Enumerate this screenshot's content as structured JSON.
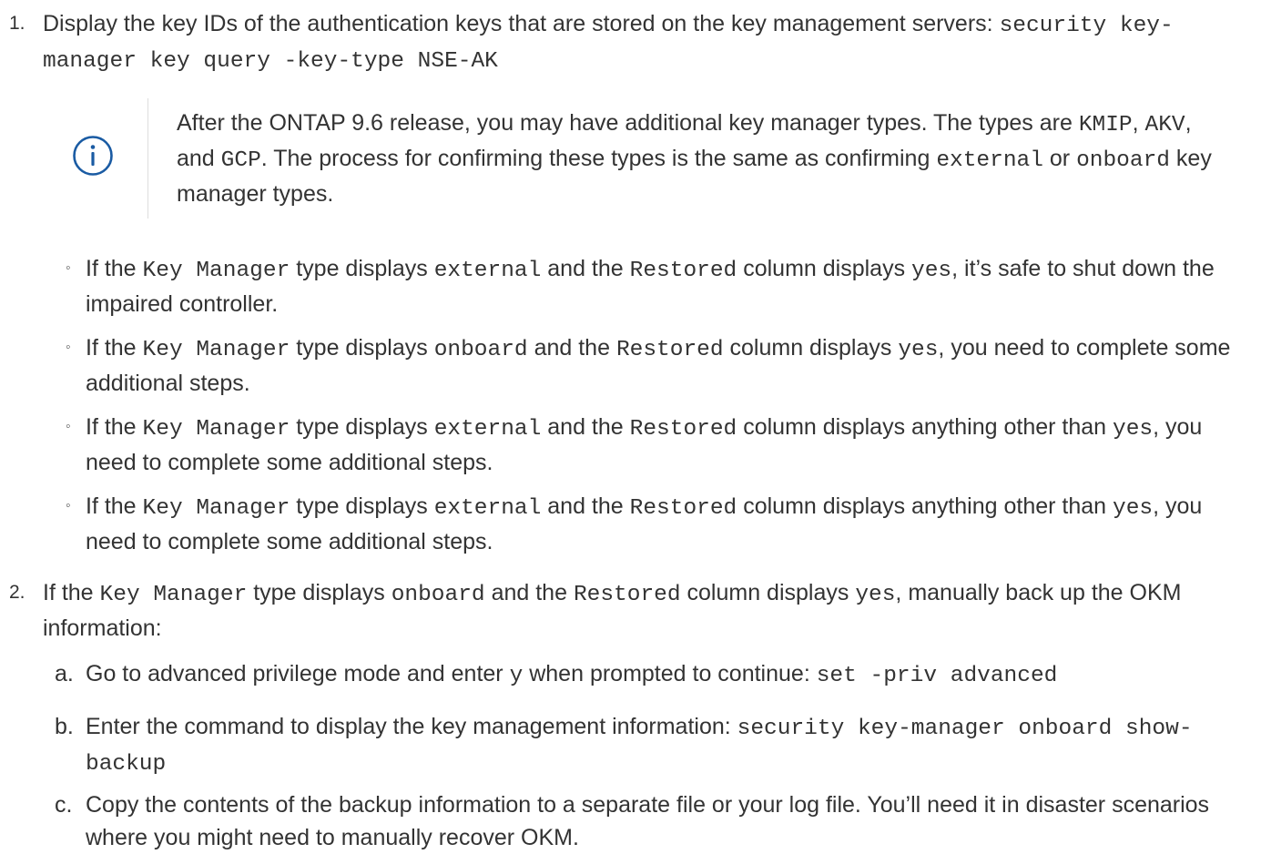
{
  "step1": {
    "number": "1.",
    "text_before": "Display the key IDs of the authentication keys that are stored on the key management servers: ",
    "command": "security key-manager key query -key-type NSE-AK"
  },
  "note": {
    "icon": "info-icon",
    "s1": "After the ONTAP 9.6 release, you may have additional key manager types. The types are ",
    "c1": "KMIP",
    "s2": ", ",
    "c2": "AKV",
    "s3": ", and ",
    "c3": "GCP",
    "s4": ". The process for confirming these types is the same as confirming ",
    "c4": "external",
    "s5": " or ",
    "c5": "onboard",
    "s6": " key manager types."
  },
  "bullets": [
    {
      "mark": "◦",
      "a": "If the ",
      "b": "Key Manager",
      "c": " type displays ",
      "d": "external",
      "e": " and the ",
      "f": "Restored",
      "g": " column displays ",
      "h": "yes",
      "i": ", it’s safe to shut down the impaired controller."
    },
    {
      "mark": "◦",
      "a": "If the ",
      "b": "Key Manager",
      "c": " type displays ",
      "d": "onboard",
      "e": " and the ",
      "f": "Restored",
      "g": " column displays ",
      "h": "yes",
      "i": ", you need to complete some additional steps."
    },
    {
      "mark": "◦",
      "a": "If the ",
      "b": "Key Manager",
      "c": " type displays ",
      "d": "external",
      "e": " and the ",
      "f": "Restored",
      "g": " column displays anything other than ",
      "h": "yes",
      "i": ", you need to complete some additional steps."
    },
    {
      "mark": "◦",
      "a": "If the ",
      "b": "Key Manager",
      "c": " type displays ",
      "d": "external",
      "e": " and the ",
      "f": "Restored",
      "g": " column displays anything other than ",
      "h": "yes",
      "i": ", you need to complete some additional steps."
    }
  ],
  "step2": {
    "number": "2.",
    "a": "If the ",
    "b": "Key Manager",
    "c": " type displays ",
    "d": "onboard",
    "e": " and the ",
    "f": "Restored",
    "g": " column displays ",
    "h": "yes",
    "i": ", manually back up the OKM information:"
  },
  "substeps": [
    {
      "mark": "a.",
      "t1": "Go to advanced privilege mode and enter ",
      "c1": "y",
      "t2": " when prompted to continue: ",
      "c2": "set -priv advanced"
    },
    {
      "mark": "b.",
      "t1": "Enter the command to display the key management information: ",
      "c1": "security key-manager onboard show-backup"
    },
    {
      "mark": "c.",
      "t1": "Copy the contents of the backup information to a separate file or your log file. You’ll need it in disaster scenarios where you might need to manually recover OKM."
    }
  ]
}
